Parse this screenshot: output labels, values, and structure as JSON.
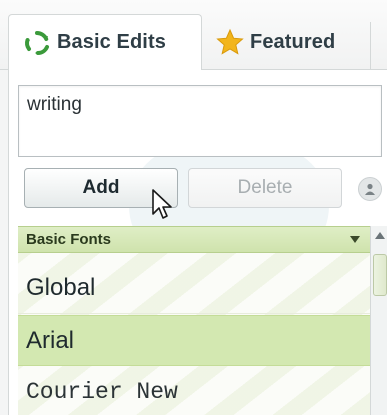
{
  "tabs": [
    {
      "label": "Basic Edits",
      "icon": "recycle-arrows-icon",
      "active": true,
      "icon_color": "#3b9a3b"
    },
    {
      "label": "Featured",
      "icon": "star-icon",
      "active": false,
      "icon_color": "#f2b51c"
    }
  ],
  "editor": {
    "text_value": "writing"
  },
  "buttons": {
    "add_label": "Add",
    "delete_label": "Delete",
    "delete_disabled": true
  },
  "font_list": {
    "header": "Basic Fonts",
    "items": [
      {
        "label": "Global",
        "selected": false
      },
      {
        "label": "Arial",
        "selected": true
      },
      {
        "label": "Courier New",
        "selected": false
      }
    ]
  },
  "colors": {
    "list_header_bg": "#cfe3ad",
    "selected_item_bg": "#d3e8b1"
  }
}
